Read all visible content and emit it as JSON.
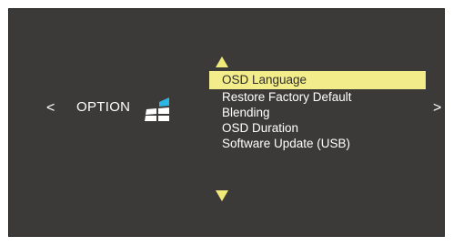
{
  "nav": {
    "prev_glyph": "<",
    "next_glyph": ">"
  },
  "category": {
    "label": "OPTION",
    "icon": "option-windows-icon"
  },
  "menu": {
    "items": [
      {
        "label": "OSD Language",
        "selected": true
      },
      {
        "label": "Restore Factory Default",
        "selected": false
      },
      {
        "label": "Blending",
        "selected": false
      },
      {
        "label": "OSD Duration",
        "selected": false
      },
      {
        "label": "Software Update (USB)",
        "selected": false
      }
    ]
  },
  "colors": {
    "background": "#3c3a39",
    "highlight": "#f3ec8a",
    "arrow": "#f2e97b",
    "icon_accent": "#2ab7e6"
  }
}
